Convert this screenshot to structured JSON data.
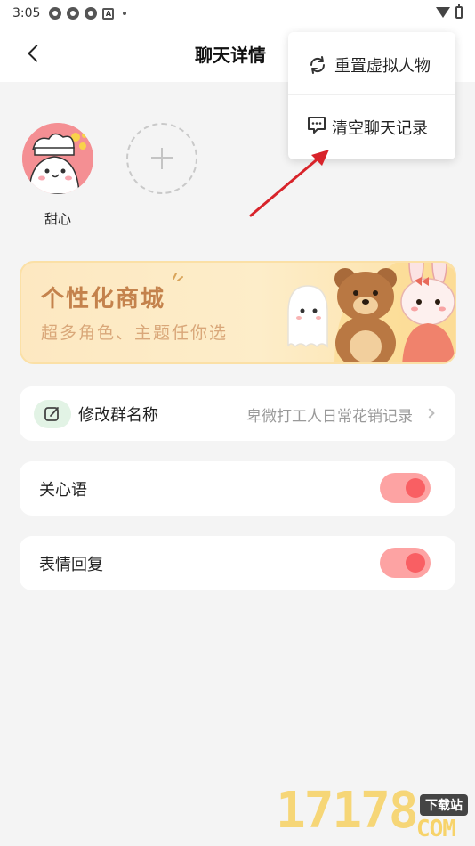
{
  "status_bar": {
    "time": "3:05"
  },
  "header": {
    "title": "聊天详情"
  },
  "members": [
    {
      "name": "甜心"
    }
  ],
  "banner": {
    "title": "个性化商城",
    "subtitle": "超多角色、主题任你选"
  },
  "settings": {
    "group_name": {
      "label": "修改群名称",
      "value": "卑微打工人日常花销记录"
    },
    "care_words": {
      "label": "关心语",
      "enabled": true
    },
    "emoji_reply": {
      "label": "表情回复",
      "enabled": true
    }
  },
  "menu": {
    "items": [
      {
        "label": "重置虚拟人物",
        "icon": "refresh-icon"
      },
      {
        "label": "清空聊天记录",
        "icon": "chat-bubble-icon"
      }
    ]
  },
  "colors": {
    "accent": "#f95f63",
    "toggle_track": "#fda3a3",
    "banner_text": "#c4824c",
    "arrow": "#d8232a"
  },
  "watermark": {
    "number": "17178",
    "badge": "下载站",
    "suffix": "COM"
  }
}
